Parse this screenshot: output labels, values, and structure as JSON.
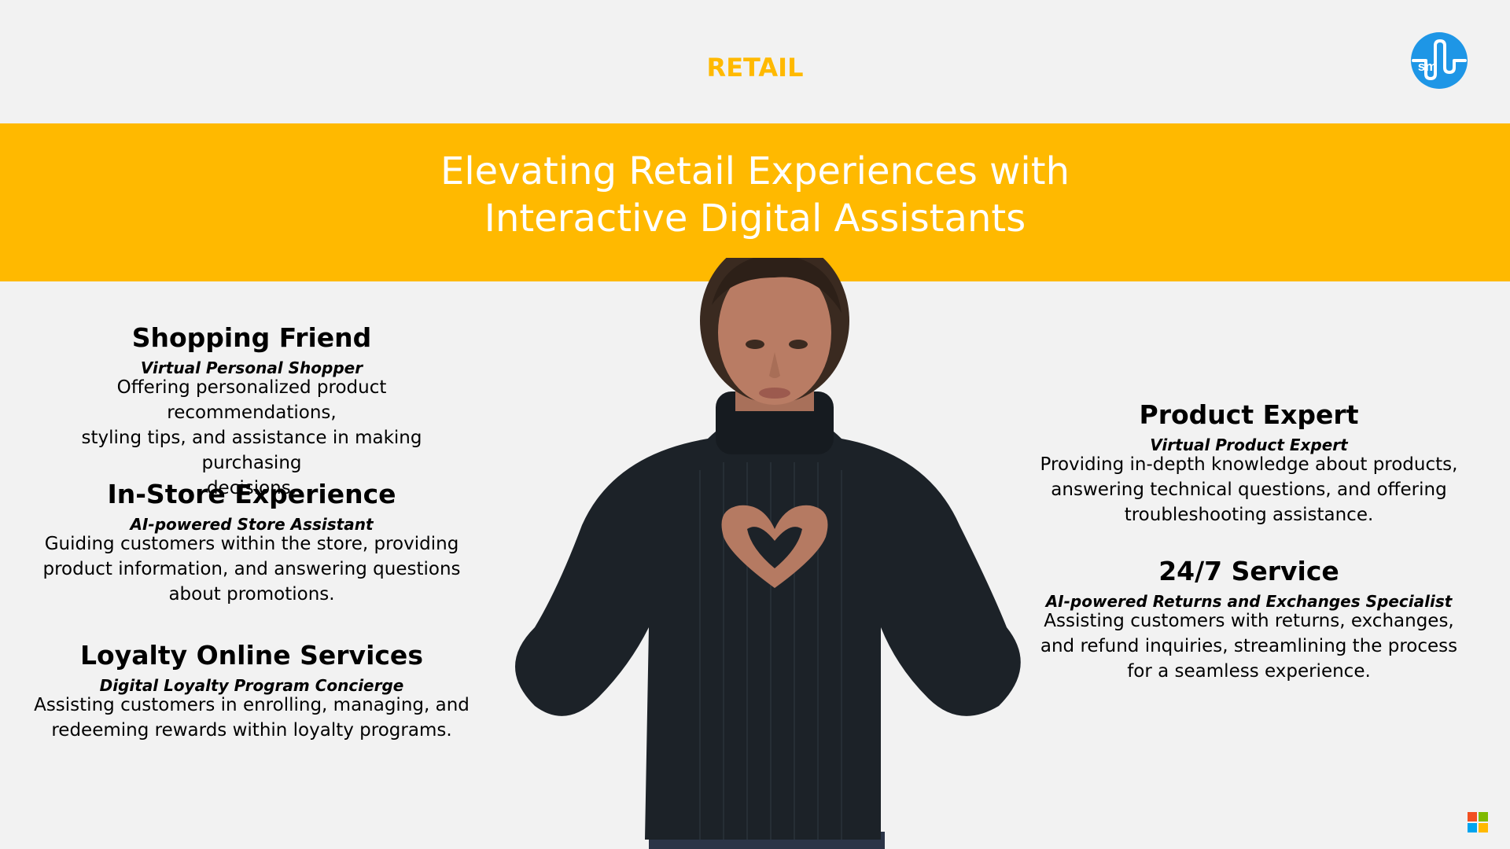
{
  "header": {
    "section_label": "RETAIL",
    "logo_text": "sm",
    "logo_icon": "sm-waveform-logo-icon",
    "accent_color": "#ffb900",
    "logo_color": "#1e96e6"
  },
  "banner": {
    "title_line1": "Elevating Retail Experiences with",
    "title_line2": "Interactive Digital Assistants",
    "background_color": "#ffb900"
  },
  "center_image": {
    "description_icon": "digital-assistant-avatar-heart-hands"
  },
  "left_features": [
    {
      "title": "Shopping Friend",
      "subtitle": "Virtual Personal Shopper",
      "desc_lines": [
        "Offering personalized product recommendations,",
        "styling tips, and assistance in making purchasing",
        "decisions."
      ]
    },
    {
      "title": "In-Store Experience",
      "subtitle": "AI-powered Store Assistant",
      "desc_lines": [
        "Guiding customers within the store, providing",
        "product information, and answering questions",
        "about promotions."
      ]
    },
    {
      "title": "Loyalty Online Services",
      "subtitle": "Digital Loyalty Program Concierge",
      "desc_lines": [
        "Assisting customers in enrolling, managing, and",
        "redeeming rewards within loyalty programs."
      ]
    }
  ],
  "right_features": [
    {
      "title": "Product Expert",
      "subtitle": "Virtual Product Expert",
      "desc_lines": [
        "Providing in-depth knowledge about products,",
        "answering technical questions, and offering",
        "troubleshooting assistance."
      ]
    },
    {
      "title": "24/7 Service",
      "subtitle": "AI-powered Returns and Exchanges Specialist",
      "desc_lines": [
        "Assisting customers with returns, exchanges,",
        "and refund inquiries, streamlining the process",
        "for a seamless experience."
      ]
    }
  ],
  "footer": {
    "ms_logo_icon": "microsoft-logo-icon",
    "ms_colors": [
      "#f25022",
      "#7fba00",
      "#00a4ef",
      "#ffb900"
    ]
  }
}
